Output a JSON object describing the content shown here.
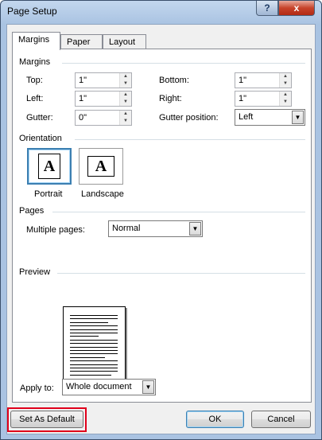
{
  "window": {
    "title": "Page Setup"
  },
  "titlebar": {
    "help_glyph": "?",
    "close_glyph": "x"
  },
  "tabs": [
    {
      "label": "Margins",
      "active": true
    },
    {
      "label": "Paper",
      "active": false
    },
    {
      "label": "Layout",
      "active": false
    }
  ],
  "margins": {
    "section_label": "Margins",
    "top": {
      "label": "Top:",
      "value": "1\""
    },
    "bottom": {
      "label": "Bottom:",
      "value": "1\""
    },
    "left": {
      "label": "Left:",
      "value": "1\""
    },
    "right": {
      "label": "Right:",
      "value": "1\""
    },
    "gutter": {
      "label": "Gutter:",
      "value": "0\""
    },
    "gutter_position": {
      "label": "Gutter position:",
      "value": "Left"
    }
  },
  "orientation": {
    "section_label": "Orientation",
    "portrait": {
      "label": "Portrait",
      "glyph": "A",
      "selected": true
    },
    "landscape": {
      "label": "Landscape",
      "glyph": "A",
      "selected": false
    }
  },
  "pages": {
    "section_label": "Pages",
    "multiple_pages": {
      "label": "Multiple pages:",
      "value": "Normal"
    }
  },
  "preview": {
    "section_label": "Preview"
  },
  "apply_to": {
    "label": "Apply to:",
    "value": "Whole document"
  },
  "buttons": {
    "set_as_default": "Set As Default",
    "ok": "OK",
    "cancel": "Cancel"
  },
  "colors": {
    "highlight": "#e0001b",
    "selection_border": "#3c7fb1"
  }
}
